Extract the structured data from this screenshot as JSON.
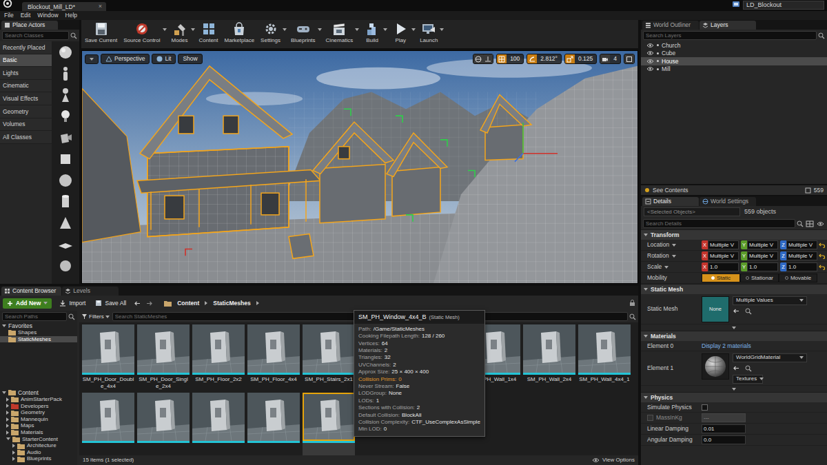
{
  "window": {
    "tab": "Blockout_Mill_LD*",
    "tab_close": "×",
    "project": "LD_Blockout"
  },
  "menu": [
    "File",
    "Edit",
    "Window",
    "Help"
  ],
  "place_actors": {
    "title": "Place Actors",
    "search_placeholder": "Search Classes",
    "categories": [
      {
        "label": "Recently Placed",
        "selected": false
      },
      {
        "label": "Basic",
        "selected": true
      },
      {
        "label": "Lights",
        "selected": false
      },
      {
        "label": "Cinematic",
        "selected": false
      },
      {
        "label": "Visual Effects",
        "selected": false
      },
      {
        "label": "Geometry",
        "selected": false
      },
      {
        "label": "Volumes",
        "selected": false
      },
      {
        "label": "All Classes",
        "selected": false
      }
    ]
  },
  "toolbar": [
    {
      "label": "Save Current",
      "dropdown": false
    },
    {
      "label": "Source Control",
      "dropdown": true
    },
    {
      "label": "Modes",
      "dropdown": true
    },
    {
      "label": "Content",
      "dropdown": false
    },
    {
      "label": "Marketplace",
      "dropdown": false
    },
    {
      "label": "Settings",
      "dropdown": true
    },
    {
      "label": "Blueprints",
      "dropdown": true
    },
    {
      "label": "Cinematics",
      "dropdown": true
    },
    {
      "label": "Build",
      "dropdown": true
    },
    {
      "label": "Play",
      "dropdown": true
    },
    {
      "label": "Launch",
      "dropdown": true
    }
  ],
  "viewport": {
    "view": "Perspective",
    "lighting": "Lit",
    "show": "Show",
    "readouts": [
      {
        "value": "100",
        "on": true
      },
      {
        "value": "2.812°",
        "on": true
      },
      {
        "value": "0.125",
        "on": true
      },
      {
        "value": "4",
        "on": false
      }
    ]
  },
  "outliner": {
    "tabs": [
      {
        "label": "World Outliner",
        "selected": false
      },
      {
        "label": "Layers",
        "selected": true
      }
    ],
    "search_placeholder": "Search Layers",
    "layers": [
      {
        "name": "Church",
        "visible": true,
        "selected": false
      },
      {
        "name": "Cube",
        "visible": true,
        "selected": false
      },
      {
        "name": "House",
        "visible": true,
        "selected": true
      },
      {
        "name": "Mill",
        "visible": true,
        "selected": false
      }
    ],
    "see_contents": "See Contents",
    "count": "559"
  },
  "details": {
    "tabs": [
      {
        "label": "Details",
        "selected": true
      },
      {
        "label": "World Settings",
        "selected": false
      }
    ],
    "selection": "<Selected Objects>",
    "objects": "559 objects",
    "search_placeholder": "Search Details",
    "sections": [
      {
        "title": "Transform",
        "expanded": true,
        "advanced": false,
        "rows": [
          {
            "kind": "vector",
            "label": "Location",
            "reset": true,
            "values": [
              {
                "axis": "X",
                "value": "Multiple V",
                "color": "#c4342c"
              },
              {
                "axis": "Y",
                "value": "Multiple V",
                "color": "#5a9b2a"
              },
              {
                "axis": "Z",
                "value": "Multiple V",
                "color": "#2f69c4"
              }
            ]
          },
          {
            "kind": "vector",
            "label": "Rotation",
            "reset": true,
            "values": [
              {
                "axis": "X",
                "value": "Multiple V",
                "color": "#c4342c"
              },
              {
                "axis": "Y",
                "value": "Multiple V",
                "color": "#5a9b2a"
              },
              {
                "axis": "Z",
                "value": "Multiple V",
                "color": "#2f69c4"
              }
            ]
          },
          {
            "kind": "vector",
            "label": "Scale",
            "reset": true,
            "values": [
              {
                "axis": "X",
                "value": "1.0",
                "color": "#c4342c"
              },
              {
                "axis": "Y",
                "value": "1.0",
                "color": "#5a9b2a"
              },
              {
                "axis": "Z",
                "value": "1.0",
                "color": "#2f69c4"
              }
            ]
          },
          {
            "kind": "segmented",
            "label": "Mobility",
            "reset": false,
            "options": [
              {
                "label": "Static",
                "selected": true
              },
              {
                "label": "Stationar",
                "selected": false
              },
              {
                "label": "Movable",
                "selected": false
              }
            ]
          }
        ]
      },
      {
        "title": "Static Mesh",
        "expanded": true,
        "advanced": true,
        "rows": [
          {
            "kind": "asset",
            "label": "Static Mesh",
            "thumb": "None",
            "value": "Multiple Values"
          }
        ]
      },
      {
        "title": "Materials",
        "expanded": true,
        "advanced": true,
        "rows": [
          {
            "kind": "link",
            "label": "Element 0",
            "value": "Display 2 materials"
          },
          {
            "kind": "material",
            "label": "Element 1",
            "value": "WorldGridMaterial",
            "extra": "Textures"
          }
        ]
      },
      {
        "title": "Physics",
        "expanded": true,
        "advanced": false,
        "rows": [
          {
            "kind": "checkbox",
            "label": "Simulate Physics",
            "checked": false
          },
          {
            "kind": "toggled-number",
            "label": "MassInKg",
            "value": "---",
            "checked": false,
            "disabled": true
          },
          {
            "kind": "number",
            "label": "Linear Damping",
            "value": "0.01",
            "disabled": false
          },
          {
            "kind": "number",
            "label": "Angular Damping",
            "value": "0.0",
            "disabled": false
          }
        ]
      }
    ]
  },
  "content_browser": {
    "tabs": [
      {
        "label": "Content Browser",
        "selected": true
      },
      {
        "label": "Levels",
        "selected": false
      }
    ],
    "add_new": "Add New",
    "import": "Import",
    "save_all": "Save All",
    "breadcrumb": [
      "Content",
      "StaticMeshes"
    ],
    "tree": {
      "search_placeholder": "Search Paths",
      "favorites": {
        "label": "Favorites",
        "expanded": true,
        "items": [
          {
            "label": "Shapes",
            "selected": false
          },
          {
            "label": "StaticMeshes",
            "selected": true
          }
        ]
      },
      "root": {
        "label": "Content",
        "expanded": true
      },
      "folders": [
        {
          "label": "AnimStarterPack",
          "expanded": false,
          "color": "#c9a66b"
        },
        {
          "label": "Developers",
          "expanded": false,
          "color": "#c0392b"
        },
        {
          "label": "Geometry",
          "expanded": false,
          "color": "#c9a66b"
        },
        {
          "label": "Mannequin",
          "expanded": false,
          "color": "#c9a66b"
        },
        {
          "label": "Maps",
          "expanded": false,
          "color": "#c9a66b"
        },
        {
          "label": "Materials",
          "expanded": false,
          "color": "#c9a66b"
        },
        {
          "label": "StarterContent",
          "expanded": true,
          "color": "#c9a66b",
          "children": [
            {
              "label": "Architecture",
              "expanded": false,
              "color": "#c9a66b"
            },
            {
              "label": "Audio",
              "expanded": false,
              "color": "#c9a66b"
            },
            {
              "label": "Blueprints",
              "expanded": false,
              "color": "#c9a66b"
            }
          ]
        }
      ]
    },
    "filters": "Filters",
    "search_placeholder": "Search StaticMeshes",
    "assets": [
      {
        "label": "SM_PH_Door_Double_4x4",
        "selected": false
      },
      {
        "label": "SM_PH_Door_Single_2x4",
        "selected": false
      },
      {
        "label": "SM_PH_Floor_2x2",
        "selected": false
      },
      {
        "label": "SM_PH_Floor_4x4",
        "selected": false
      },
      {
        "label": "SM_PH_Stairs_2x1",
        "selected": false
      },
      {
        "selected": false
      },
      {
        "selected": false
      },
      {
        "label": "SM_PH_Wall_1x4",
        "selected": false
      },
      {
        "label": "SM_PH_Wall_2x4",
        "selected": false
      },
      {
        "label": "SM_PH_Wall_4x4_1",
        "selected": false
      },
      {
        "selected": false
      },
      {
        "selected": false
      },
      {
        "selected": false
      },
      {
        "selected": false
      },
      {
        "selected": true
      }
    ],
    "status": "15 items (1 selected)",
    "view_options": "View Options"
  },
  "tooltip": {
    "title": "SM_PH_Window_4x4_B",
    "type": "(Static Mesh)",
    "rows": [
      {
        "key": "Path:",
        "value": "/Game/StaticMeshes",
        "warning": false
      },
      {
        "key": "Cooking Filepath Length:",
        "value": "128 / 260",
        "warning": false
      },
      {
        "key": "Vertices:",
        "value": "64",
        "warning": false
      },
      {
        "key": "Materials:",
        "value": "2",
        "warning": false
      },
      {
        "key": "Triangles:",
        "value": "32",
        "warning": false
      },
      {
        "key": "UVChannels:",
        "value": "2",
        "warning": false
      },
      {
        "key": "Approx Size:",
        "value": "25 × 400 × 400",
        "warning": false
      },
      {
        "key": "Collision Prims:",
        "value": "0",
        "warning": true
      },
      {
        "key": "Never Stream:",
        "value": "False",
        "warning": false
      },
      {
        "key": "LODGroup:",
        "value": "None",
        "warning": false
      },
      {
        "key": "LODs:",
        "value": "1",
        "warning": false
      },
      {
        "key": "Sections with Collision:",
        "value": "2",
        "warning": false
      },
      {
        "key": "Default Collision:",
        "value": "BlockAll",
        "warning": false
      },
      {
        "key": "Collision Complexity:",
        "value": "CTF_UseComplexAsSimple",
        "warning": false
      },
      {
        "key": "Min LOD:",
        "value": "0",
        "warning": false
      }
    ]
  }
}
